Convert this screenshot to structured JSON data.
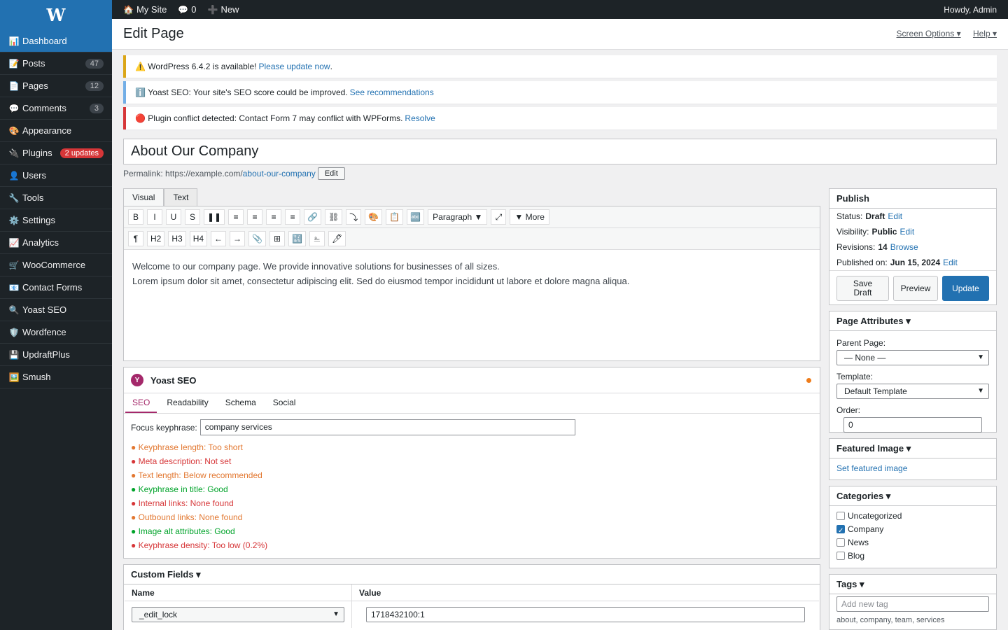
{
  "sidebar": {
    "logo": "W",
    "items": [
      {
        "label": "Dashboard",
        "icon": "📊",
        "active": true
      },
      {
        "label": "Posts",
        "icon": "📝",
        "count": "47"
      },
      {
        "label": "Pages",
        "icon": "📄",
        "count": "12"
      },
      {
        "label": "Comments",
        "icon": "💬",
        "count": "3"
      },
      {
        "label": "Appearance",
        "icon": "🎨"
      },
      {
        "label": "Plugins",
        "icon": "🔌",
        "count": "2 updates",
        "count_style": "red"
      },
      {
        "label": "Users",
        "icon": "👤"
      },
      {
        "label": "Tools",
        "icon": "🔧"
      },
      {
        "label": "Settings",
        "icon": "⚙️"
      },
      {
        "label": "Analytics",
        "icon": "📈"
      },
      {
        "label": "WooCommerce",
        "icon": "🛒"
      },
      {
        "label": "Contact Forms",
        "icon": "📧"
      },
      {
        "label": "Yoast SEO",
        "icon": "🔍"
      },
      {
        "label": "Wordfence",
        "icon": "🛡️"
      },
      {
        "label": "UpdraftPlus",
        "icon": "💾"
      },
      {
        "label": "Smush",
        "icon": "🖼️"
      }
    ]
  },
  "adminbar": {
    "site_icon": "🏠",
    "site": "My Site",
    "comments_icon": "💬",
    "comments": "0",
    "new_icon": "➕",
    "new": "New",
    "howdy": "Howdy, Admin"
  },
  "header": {
    "title": "Edit Page",
    "screen_options": "Screen Options ▾",
    "help": "Help ▾"
  },
  "notices": [
    {
      "icon": "⚠️",
      "text": "WordPress 6.4.2 is available!",
      "link": "Please update now",
      "suffix": ".",
      "color": "#dba617"
    },
    {
      "icon": "ℹ️",
      "text": "Yoast SEO: Your site's SEO score could be improved.",
      "link": "See recommendations",
      "suffix": "",
      "color": "#72aee6"
    },
    {
      "icon": "🔴",
      "text": "Plugin conflict detected: Contact Form 7 may conflict with WPForms.",
      "link": "Resolve",
      "suffix": "",
      "color": "#d63638"
    }
  ],
  "post": {
    "title": "About Our Company",
    "permalink_label": "Permalink:",
    "permalink_base": "https://example.com/",
    "permalink_slug": "about-our-company",
    "permalink_edit": "Edit"
  },
  "editor": {
    "tabs": [
      "Visual",
      "Text"
    ],
    "row1": [
      "B",
      "I",
      "U",
      "S",
      "❚❚",
      "≡",
      "≡",
      "≡",
      "≡",
      "🔗",
      "⛓",
      "⤵",
      "🎨",
      "📋",
      "🔤"
    ],
    "format": "Paragraph ▼",
    "expand": "⤢",
    "more": "▼ More",
    "row2": [
      "¶",
      "H2",
      "H3",
      "H4",
      "←",
      "→",
      "📎",
      "⊞",
      "🔣",
      "⎁",
      "🖊"
    ],
    "content": [
      "Welcome to our company page. We provide innovative solutions for businesses of all sizes.",
      "Lorem ipsum dolor sit amet, consectetur adipiscing elit. Sed do eiusmod tempor incididunt ut labore et dolore magna aliqua."
    ]
  },
  "yoast": {
    "logo": "Y",
    "title": "Yoast SEO",
    "tabs": [
      "SEO",
      "Readability",
      "Schema",
      "Social"
    ],
    "focus_label": "Focus keyphrase:",
    "focus_value": "company services",
    "checks": [
      {
        "text": "● Keyphrase length: Too short",
        "color": "#e27730"
      },
      {
        "text": "● Meta description: Not set",
        "color": "#d63638"
      },
      {
        "text": "● Text length: Below recommended",
        "color": "#e27730"
      },
      {
        "text": "● Keyphrase in title: Good",
        "color": "#00a32a"
      },
      {
        "text": "● Internal links: None found",
        "color": "#d63638"
      },
      {
        "text": "● Outbound links: None found",
        "color": "#e27730"
      },
      {
        "text": "● Image alt attributes: Good",
        "color": "#00a32a"
      },
      {
        "text": "● Keyphrase density: Too low (0.2%)",
        "color": "#d63638"
      }
    ]
  },
  "custom_fields": {
    "title": "Custom Fields ▾",
    "col_name": "Name",
    "col_value": "Value",
    "row_name": "_edit_lock",
    "row_value": "1718432100:1"
  },
  "publish": {
    "title": "Publish",
    "status_label": "Status:",
    "status": "Draft",
    "status_edit": "Edit",
    "visibility_label": "Visibility:",
    "visibility": "Public",
    "visibility_edit": "Edit",
    "revisions_label": "Revisions:",
    "revisions": "14",
    "revisions_browse": "Browse",
    "published_label": "Published on:",
    "published": "Jun 15, 2024",
    "published_edit": "Edit",
    "save_draft": "Save Draft",
    "preview": "Preview",
    "update": "Update"
  },
  "page_attributes": {
    "title": "Page Attributes ▾",
    "parent_label": "Parent Page:",
    "parent_value": "— None —",
    "template_label": "Template:",
    "template_value": "Default Template",
    "order_label": "Order:",
    "order_value": "0"
  },
  "featured_image": {
    "title": "Featured Image ▾",
    "link": "Set featured image"
  },
  "categories": {
    "title": "Categories ▾",
    "items": [
      {
        "label": "Uncategorized",
        "checked": false
      },
      {
        "label": "Company",
        "checked": true
      },
      {
        "label": "News",
        "checked": false
      },
      {
        "label": "Blog",
        "checked": false
      }
    ]
  },
  "tags": {
    "title": "Tags ▾",
    "placeholder": "Add new tag",
    "current": "about, company, team, services"
  }
}
